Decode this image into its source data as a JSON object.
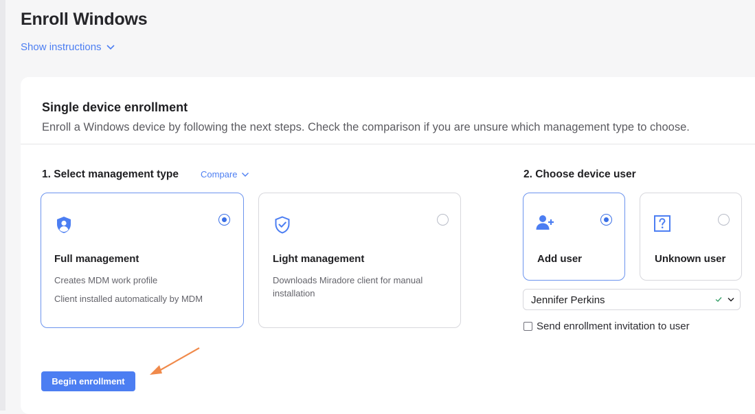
{
  "page": {
    "title": "Enroll Windows",
    "instructions_link": "Show instructions"
  },
  "card": {
    "title": "Single device enrollment",
    "description": "Enroll a Windows device by following the next steps. Check the comparison if you are unsure which management type to choose."
  },
  "step1": {
    "label": "1. Select management type",
    "compare_link": "Compare",
    "options": [
      {
        "title": "Full management",
        "lines": [
          "Creates MDM work profile",
          "Client installed automatically by MDM"
        ],
        "selected": true,
        "icon": "user-shield-icon"
      },
      {
        "title": "Light management",
        "lines": [
          "Downloads Miradore client for manual",
          "installation"
        ],
        "selected": false,
        "icon": "shield-check-icon"
      }
    ]
  },
  "step2": {
    "label": "2. Choose device user",
    "options": [
      {
        "title": "Add user",
        "selected": true,
        "icon": "add-user-icon"
      },
      {
        "title": "Unknown user",
        "selected": false,
        "icon": "question-box-icon"
      }
    ],
    "user_select": {
      "value": "Jennifer Perkins"
    },
    "invite_checkbox": {
      "label": "Send enrollment invitation to user",
      "checked": false
    }
  },
  "actions": {
    "begin_label": "Begin enrollment"
  },
  "colors": {
    "accent": "#4c7ef2",
    "annotation_arrow": "#f08a4b",
    "selected_border": "#6b93ee"
  }
}
